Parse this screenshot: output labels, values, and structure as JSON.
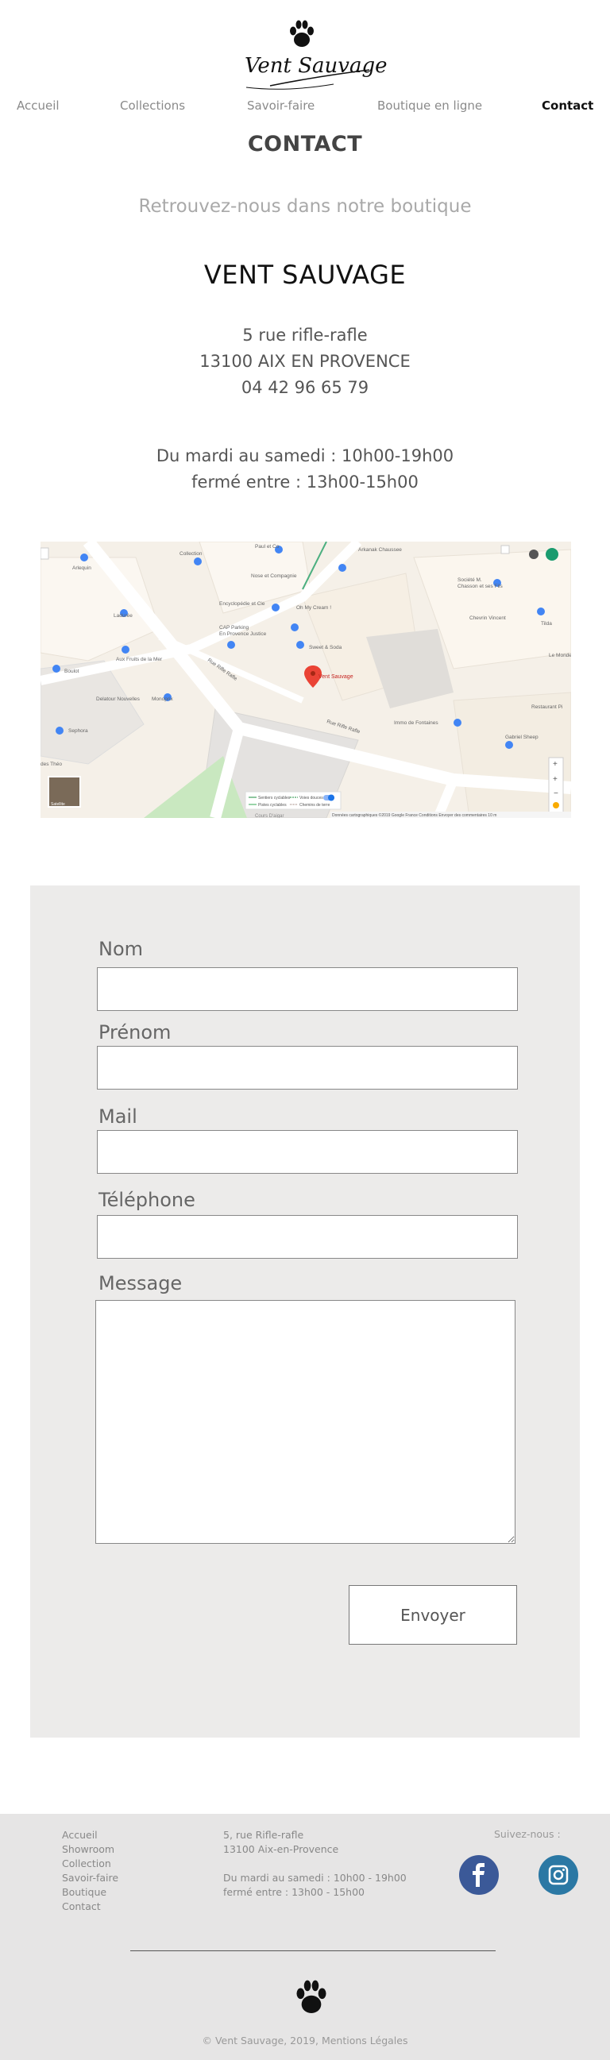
{
  "brand": {
    "name": "Vent Sauvage",
    "logo_text": "Vent Sauvage"
  },
  "nav": {
    "items": [
      {
        "label": "Accueil"
      },
      {
        "label": "Collections"
      },
      {
        "label": "Savoir-faire"
      },
      {
        "label": "Boutique en ligne"
      },
      {
        "label": "Contact"
      }
    ],
    "active": "Contact"
  },
  "page": {
    "title": "CONTACT",
    "subtitle": "Retrouvez-nous dans notre boutique",
    "shop_name": "VENT SAUVAGE",
    "address_line1": "5 rue rifle-rafle",
    "address_line2": "13100 AIX EN PROVENCE",
    "phone": "04 42 96 65 79",
    "hours_line1": "Du mardi au samedi : 10h00-19h00",
    "hours_line2": "fermé entre :  13h00-15h00"
  },
  "map": {
    "marker_label": "Vent Sauvage",
    "places": [
      "Collection",
      "Paul et Co",
      "Arkanak Chaussee",
      "Nose et Compagnie",
      "Encyclopédie et Cie",
      "Oh My Cream !",
      "Chevrin Vincent",
      "Société M. Chasson et ses Fils",
      "Ladurée",
      "Aux Fruits de la Mer",
      "Boulot",
      "Delatour Nouvelles",
      "Monoprix",
      "Sweet & Soda",
      "Immo de Fontaines",
      "Sephora",
      "Gabriel Sheep",
      "Le Monde",
      "Restaurant Pi",
      "des Théo",
      "CAP Parking",
      "Relais Aix"
    ],
    "streets": [
      "Rue Rifle Rafle",
      "Rue Rifle Rafle"
    ],
    "legend": [
      "Sentiers cyclables",
      "Voies douces",
      "Pistes cyclables",
      "Chemins de terre"
    ],
    "attribution": "Données cartographiques ©2019 Google   France   Conditions   Envoyer des commentaires   10 m",
    "satellite_label": "Satellite",
    "bottom_label": "Cours D'aigar"
  },
  "form": {
    "fields": [
      {
        "label": "Nom",
        "value": "",
        "placeholder": ""
      },
      {
        "label": "Prénom",
        "value": "",
        "placeholder": ""
      },
      {
        "label": "Mail",
        "value": "",
        "placeholder": ""
      },
      {
        "label": "Téléphone",
        "value": "",
        "placeholder": ""
      }
    ],
    "message_label": "Message",
    "message_value": "",
    "submit_label": "Envoyer"
  },
  "footer": {
    "links": [
      {
        "label": "Accueil"
      },
      {
        "label": "Showroom"
      },
      {
        "label": "Collection"
      },
      {
        "label": "Savoir-faire"
      },
      {
        "label": "Boutique"
      },
      {
        "label": "Contact"
      }
    ],
    "address_line1": "5, rue Rifle-rafle",
    "address_line2": "13100 Aix-en-Provence",
    "hours_line1": "Du mardi au samedi : 10h00 - 19h00",
    "hours_line2": "fermé entre : 13h00 - 15h00",
    "follow_label": "Suivez-nous :",
    "social": [
      {
        "icon": "facebook-icon",
        "color": "#3b5998"
      },
      {
        "icon": "instagram-icon",
        "color": "#2b78a4"
      }
    ],
    "copyright": "© Vent Sauvage, 2019, Mentions Légales"
  }
}
